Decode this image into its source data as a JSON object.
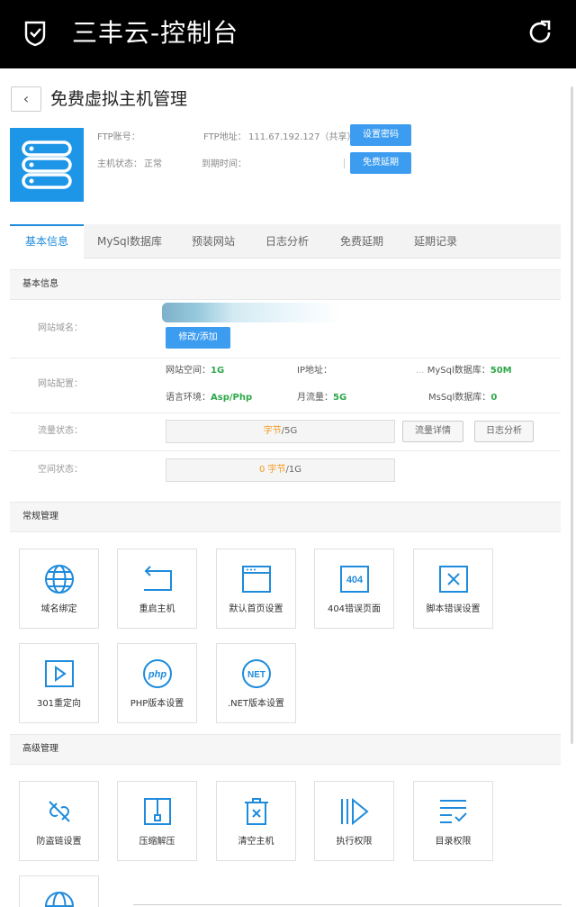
{
  "app": {
    "title": "三丰云-控制台"
  },
  "header": {
    "back_label": "‹",
    "title": "免费虚拟主机管理"
  },
  "host": {
    "ftp_account_label": "FTP账号：",
    "ftp_address_label": "FTP地址：",
    "ftp_address_value": "111.67.192.127（共享）",
    "status_label": "主机状态：",
    "status_value": "正常",
    "expire_label": "到期时间：",
    "set_password_label": "设置密码",
    "free_extend_label": "免费延期"
  },
  "tabs": [
    "基本信息",
    "MySql数据库",
    "预装网站",
    "日志分析",
    "免费延期",
    "延期记录"
  ],
  "basic": {
    "section_title": "基本信息",
    "domain_label": "网站域名：",
    "edit_label": "修改/添加",
    "config_label": "网站配置：",
    "space_key": "网站空间：",
    "space_val": "1G",
    "ip_key": "IP地址：",
    "mysql_key": "MySql数据库：",
    "mysql_prefix": "...",
    "mysql_val": "50M",
    "lang_key": "语言环境：",
    "lang_val": "Asp/Php",
    "traffic_key": "月流量：",
    "traffic_val": "5G",
    "mssql_key": "MsSql数据库：",
    "mssql_val": "0",
    "flow_label": "流量状态：",
    "flow_used": "字节",
    "flow_total": "/5G",
    "flow_detail": "流量详情",
    "log_analysis": "日志分析",
    "space_status_label": "空间状态：",
    "space_used": "0 字节",
    "space_total": "/1G"
  },
  "routine": {
    "section_title": "常规管理",
    "items": [
      {
        "label": "域名绑定",
        "icon": "globe-icon"
      },
      {
        "label": "重启主机",
        "icon": "restart-icon"
      },
      {
        "label": "默认首页设置",
        "icon": "browser-window-icon"
      },
      {
        "label": "404错误页面",
        "icon": "404-icon"
      },
      {
        "label": "脚本错误设置",
        "icon": "x-box-icon"
      },
      {
        "label": "301重定向",
        "icon": "play-box-icon"
      },
      {
        "label": "PHP版本设置",
        "icon": "php-icon"
      },
      {
        "label": ".NET版本设置",
        "icon": "net-icon"
      }
    ]
  },
  "advanced": {
    "section_title": "高级管理",
    "items": [
      {
        "label": "防盗链设置",
        "icon": "broken-link-icon"
      },
      {
        "label": "压缩解压",
        "icon": "zip-icon"
      },
      {
        "label": "清空主机",
        "icon": "trash-icon"
      },
      {
        "label": "执行权限",
        "icon": "execute-icon"
      },
      {
        "label": "目录权限",
        "icon": "list-check-icon"
      }
    ]
  },
  "colors": {
    "accent": "#1e96e8",
    "button": "#3c9cf0",
    "green": "#2ea84a",
    "orange": "#f29a1e"
  }
}
